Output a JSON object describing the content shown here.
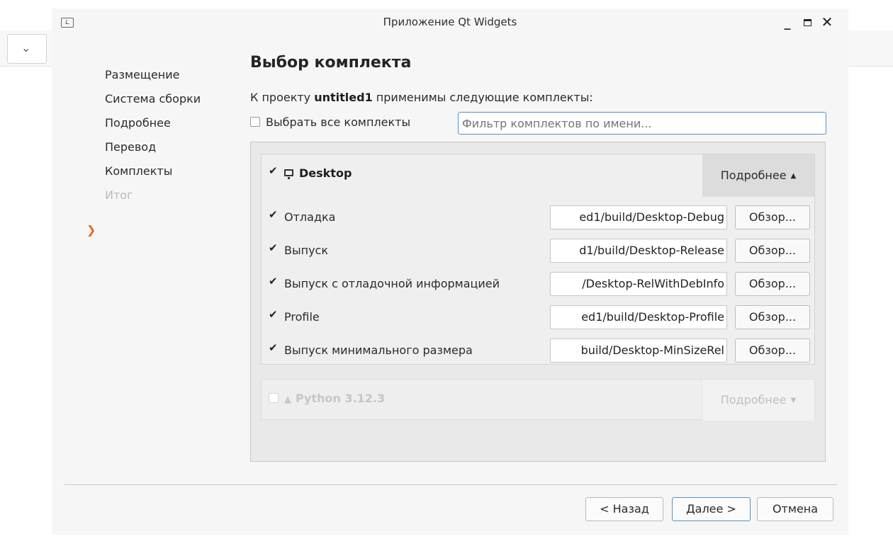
{
  "window": {
    "title": "Приложение Qt Widgets"
  },
  "steps": [
    {
      "label": "Размещение",
      "state": "done"
    },
    {
      "label": "Система сборки",
      "state": "done"
    },
    {
      "label": "Подробнее",
      "state": "done"
    },
    {
      "label": "Перевод",
      "state": "done"
    },
    {
      "label": "Комплекты",
      "state": "current"
    },
    {
      "label": "Итог",
      "state": "disabled"
    }
  ],
  "page": {
    "heading": "Выбор комплекта",
    "intro_prefix": "К проекту ",
    "project_name": "untitled1",
    "intro_suffix": " применимы следующие комплекты:",
    "select_all_label": "Выбрать все комплекты",
    "filter_placeholder": "Фильтр комплектов по имени..."
  },
  "kits": [
    {
      "name": "Desktop",
      "checked": true,
      "icon": "monitor-icon",
      "details_label": "Подробнее",
      "configs": [
        {
          "label": "Отладка",
          "checked": true,
          "path": "ed1/build/Desktop-Debug",
          "browse": "Обзор..."
        },
        {
          "label": "Выпуск",
          "checked": true,
          "path": "d1/build/Desktop-Release",
          "browse": "Обзор..."
        },
        {
          "label": "Выпуск с отладочной информацией",
          "checked": true,
          "path": "/Desktop-RelWithDebInfo",
          "browse": "Обзор..."
        },
        {
          "label": "Profile",
          "checked": true,
          "path": "ed1/build/Desktop-Profile",
          "browse": "Обзор..."
        },
        {
          "label": "Выпуск минимального размера",
          "checked": true,
          "path": "build/Desktop-MinSizeRel",
          "browse": "Обзор..."
        }
      ]
    },
    {
      "name": "Python 3.12.3",
      "checked": false,
      "icon": "warning-icon",
      "details_label": "Подробнее",
      "disabled": true
    }
  ],
  "buttons": {
    "back": "< Назад",
    "next": "Далее >",
    "cancel": "Отмена"
  },
  "colors": {
    "current_step_arrow": "#e06b1f",
    "focus_border": "#4f93cf"
  }
}
